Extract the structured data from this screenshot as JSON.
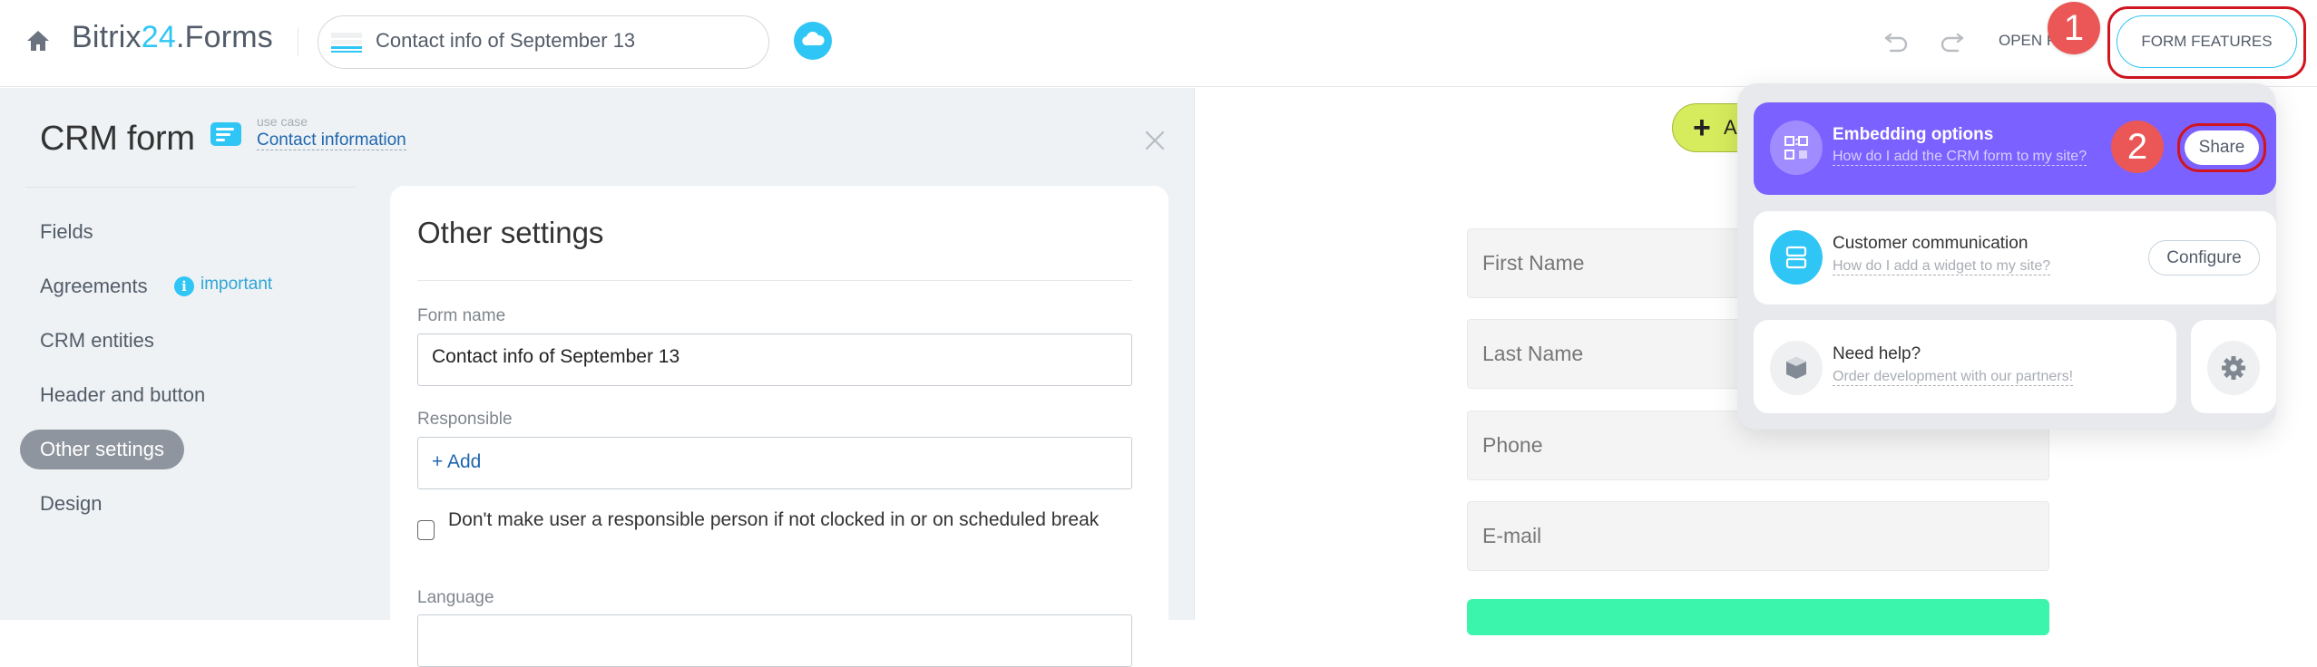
{
  "header": {
    "logo_main": "Bitrix",
    "logo_accent": "24",
    "logo_suffix": ".Forms",
    "form_name": "Contact info of September 13",
    "open_form_label": "OPEN F",
    "form_features_label": "FORM FEATURES",
    "annotation_1": "1"
  },
  "left_panel": {
    "title": "CRM form",
    "use_case_label": "use case",
    "use_case_value": "Contact information",
    "nav": [
      {
        "label": "Fields",
        "active": false
      },
      {
        "label": "Agreements",
        "active": false,
        "badge": "important"
      },
      {
        "label": "CRM entities",
        "active": false
      },
      {
        "label": "Header and button",
        "active": false
      },
      {
        "label": "Other settings",
        "active": true
      },
      {
        "label": "Design",
        "active": false
      }
    ]
  },
  "settings": {
    "title": "Other settings",
    "form_name_label": "Form name",
    "form_name_value": "Contact info of September 13",
    "responsible_label": "Responsible",
    "responsible_add": "+ Add",
    "checkbox_label": "Don't make user a responsible person if not clocked in or on scheduled break",
    "checkbox_checked": false,
    "language_label": "Language"
  },
  "preview": {
    "add_button_label": "A",
    "fields": [
      "First Name",
      "Last Name",
      "Phone",
      "E-mail"
    ],
    "submit_color": "#3bf5ad"
  },
  "popup": {
    "embedding": {
      "title": "Embedding options",
      "subtitle": "How do I add the CRM form to my site?",
      "button": "Share",
      "annotation": "2"
    },
    "communication": {
      "title": "Customer communication",
      "subtitle": "How do I add a widget to my site?",
      "button": "Configure"
    },
    "help": {
      "title": "Need help?",
      "subtitle": "Order development with our partners!"
    }
  },
  "colors": {
    "accent": "#2fc6f6",
    "embedding_bg": "#7b61ff",
    "annotation_red": "#eb5757",
    "annotation_outline": "#d0151f",
    "add_button": "#d7ec5c"
  }
}
